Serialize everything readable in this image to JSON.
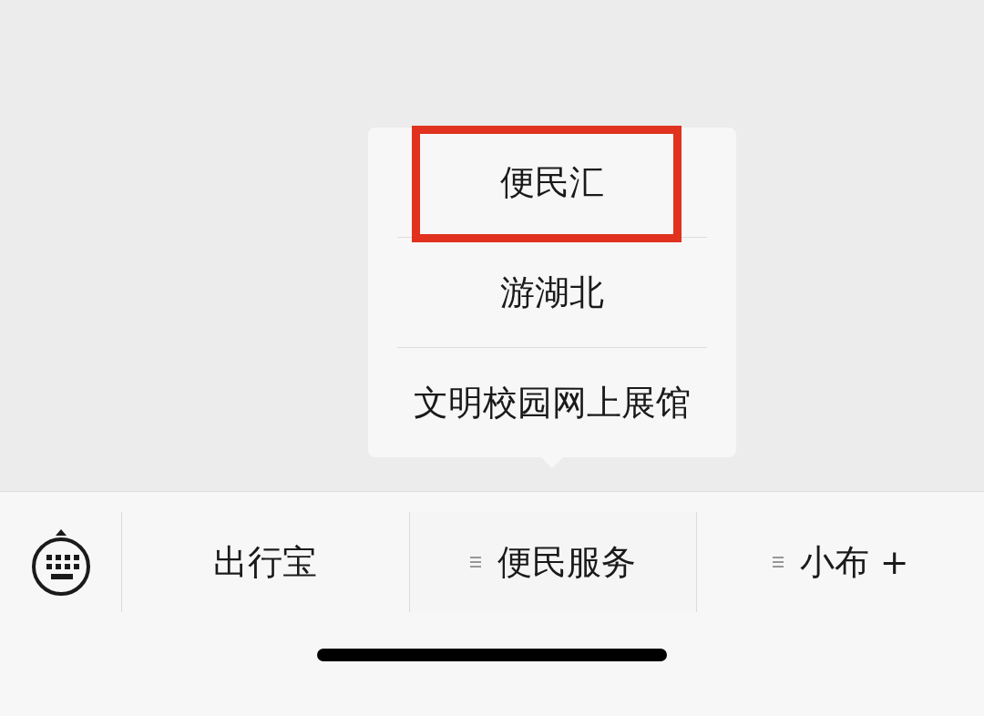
{
  "popup_menu": {
    "items": [
      {
        "label": "便民汇",
        "highlighted": true
      },
      {
        "label": "游湖北",
        "highlighted": false
      },
      {
        "label": "文明校园网上展馆",
        "highlighted": false
      }
    ]
  },
  "bottom_menu": {
    "tabs": [
      {
        "label": "出行宝",
        "menu_icon": false,
        "expanded": false
      },
      {
        "label": "便民服务",
        "menu_icon": true,
        "expanded": true
      },
      {
        "label": "小布 +",
        "menu_icon": true,
        "expanded": false
      }
    ]
  }
}
